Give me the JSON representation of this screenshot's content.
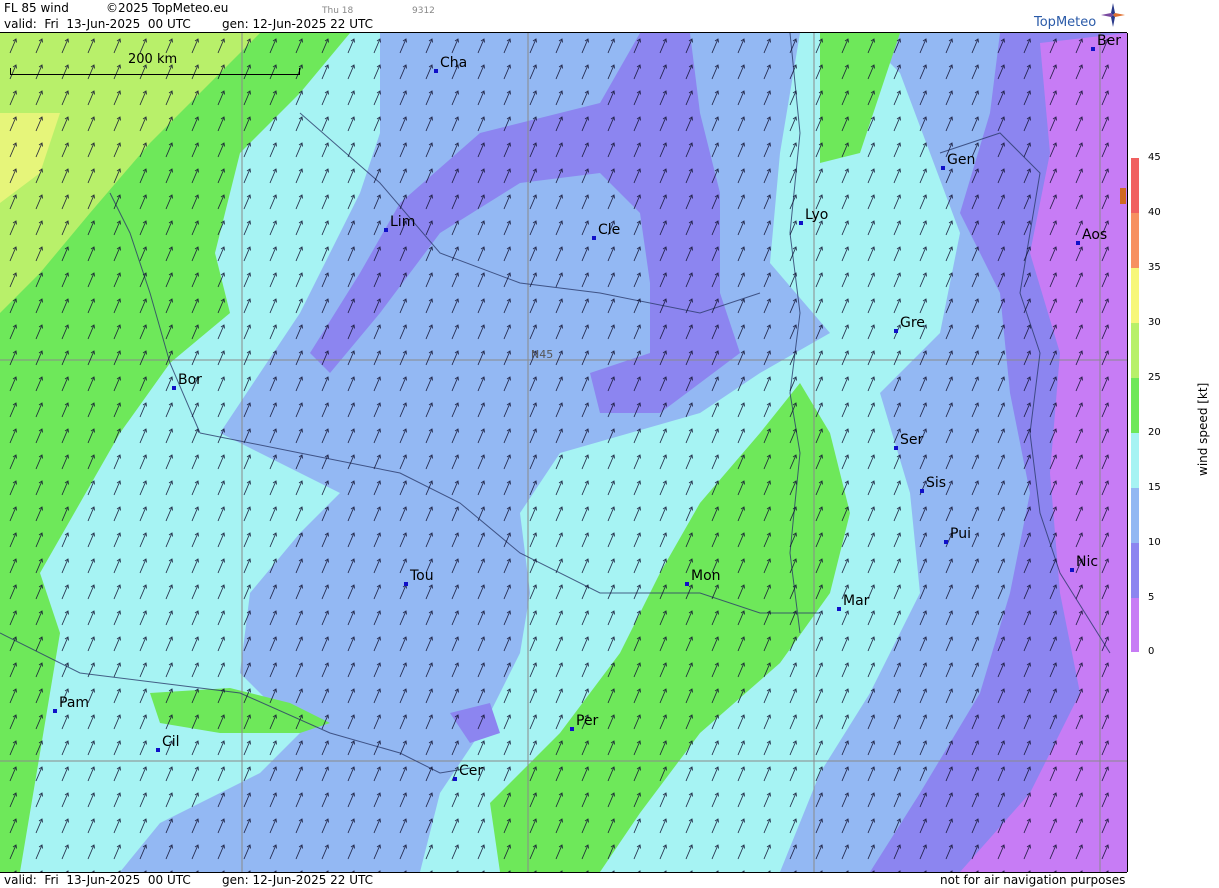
{
  "header": {
    "title": "FL 85 wind",
    "copyright": "©2025 TopMeteo.eu",
    "day_marker": "Thu 18",
    "code": "9312",
    "valid": "valid:  Fri  13-Jun-2025  00 UTC",
    "gen": "gen: 12-Jun-2025 22 UTC",
    "brand": "TopMeteo"
  },
  "footer": {
    "valid": "valid:  Fri  13-Jun-2025  00 UTC",
    "gen": "gen: 12-Jun-2025 22 UTC",
    "disclaimer": "not for air navigation purposes"
  },
  "map": {
    "scale_label": "200 km",
    "grid_label": "N45",
    "cities": [
      {
        "label": "Cha"
      },
      {
        "label": "Lim"
      },
      {
        "label": "Cle"
      },
      {
        "label": "Lyo"
      },
      {
        "label": "Gen"
      },
      {
        "label": "Ber"
      },
      {
        "label": "Aos"
      },
      {
        "label": "Gre"
      },
      {
        "label": "Bor"
      },
      {
        "label": "Ser"
      },
      {
        "label": "Sis"
      },
      {
        "label": "Pui"
      },
      {
        "label": "Nic"
      },
      {
        "label": "Tou"
      },
      {
        "label": "Mon"
      },
      {
        "label": "Mar"
      },
      {
        "label": "Pam"
      },
      {
        "label": "Cil"
      },
      {
        "label": "Per"
      },
      {
        "label": "Cer"
      }
    ],
    "wind_direction": "from SSW",
    "colors": {
      "0-5": "#c77cf5",
      "5-10": "#8c85f0",
      "10-15": "#93b8f3",
      "15-20": "#a6f3f3",
      "20-25": "#6ee85a",
      "25-30": "#b8f06a",
      "30-35": "#f7f77a",
      "35-40": "#f7c86a",
      "40-45": "#f79060",
      "45+": "#f06060"
    }
  },
  "legend": {
    "unit": "wind speed [kt]",
    "ticks": [
      "45",
      "40",
      "35",
      "30",
      "25",
      "20",
      "15",
      "10",
      "5",
      "0"
    ]
  }
}
